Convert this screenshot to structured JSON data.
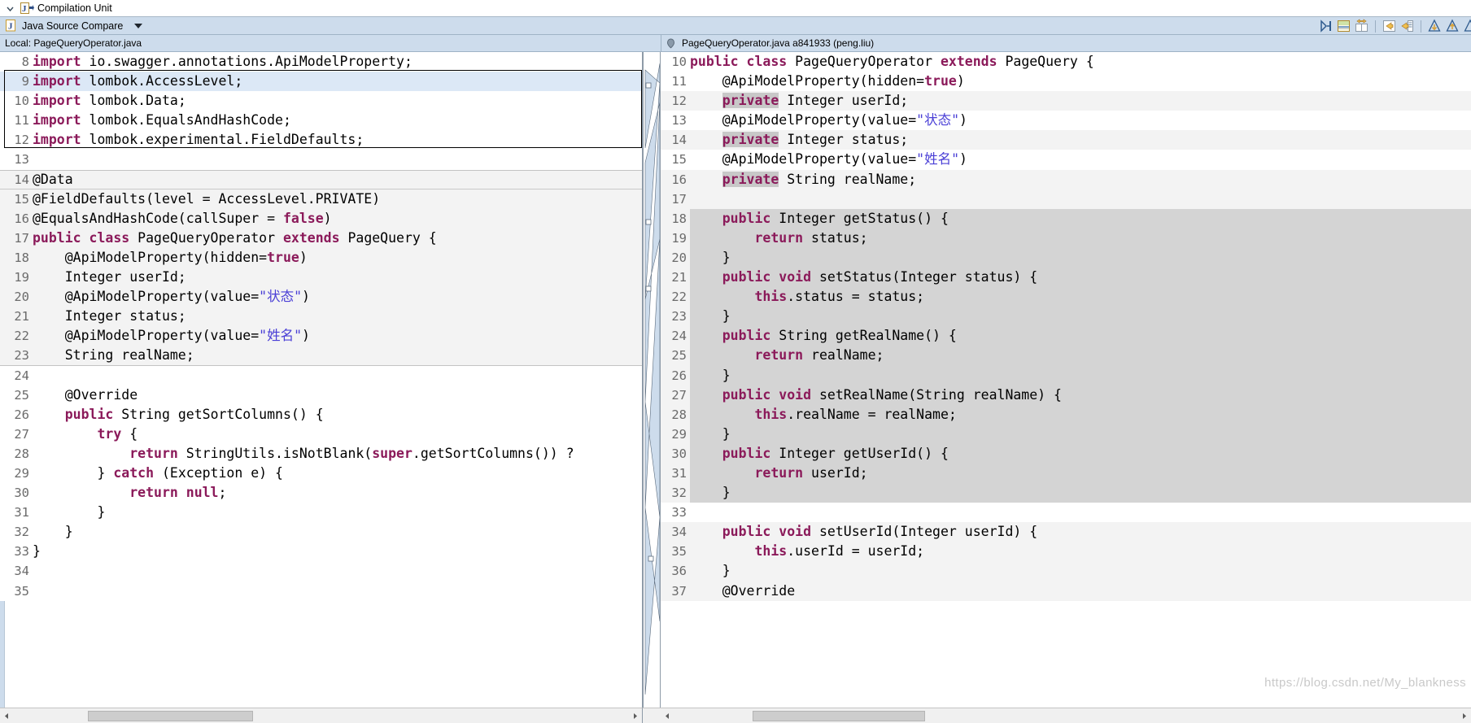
{
  "window": {
    "compilation_unit_label": "Compilation Unit",
    "twisty_icon": "chevron-down-icon",
    "java_file_icon": "java-compilation-unit-icon"
  },
  "compare_bar": {
    "title": "Java Source Compare",
    "icon": "java-file-icon",
    "dropdown_icon": "caret-down-icon",
    "toolbar": [
      {
        "name": "next-difference-icon",
        "tooltip": "Next Difference"
      },
      {
        "name": "two-pane-layout-icon",
        "tooltip": "Two Pane Layout"
      },
      {
        "name": "switch-layout-icon",
        "tooltip": "Switch Layout"
      },
      {
        "name": "copy-all-left-icon",
        "tooltip": "Copy All from Right to Left"
      },
      {
        "name": "copy-current-left-icon",
        "tooltip": "Copy Current Change from Right to Left"
      },
      {
        "name": "next-change-icon",
        "tooltip": "Next Change"
      },
      {
        "name": "previous-change-icon",
        "tooltip": "Previous Change"
      },
      {
        "name": "next-difference-arrow-icon",
        "tooltip": "Next Difference"
      }
    ]
  },
  "panes": {
    "left": {
      "header": "Local: PageQueryOperator.java",
      "first_line_number": 8,
      "lines": [
        {
          "n": 8,
          "bg": "white",
          "tokens": [
            {
              "t": "import",
              "c": "kw"
            },
            {
              "t": " io.swagger.annotations.ApiModelProperty;",
              "c": "pl"
            }
          ]
        },
        {
          "n": 9,
          "bg": "sel",
          "tokens": [
            {
              "t": "import",
              "c": "kw"
            },
            {
              "t": " lombok.AccessLevel;",
              "c": "pl"
            }
          ]
        },
        {
          "n": 10,
          "bg": "white",
          "tokens": [
            {
              "t": "import",
              "c": "kw"
            },
            {
              "t": " lombok.Data;",
              "c": "pl"
            }
          ]
        },
        {
          "n": 11,
          "bg": "white",
          "tokens": [
            {
              "t": "import",
              "c": "kw"
            },
            {
              "t": " lombok.EqualsAndHashCode;",
              "c": "pl"
            }
          ]
        },
        {
          "n": 12,
          "bg": "white",
          "tokens": [
            {
              "t": "import",
              "c": "kw"
            },
            {
              "t": " lombok.experimental.FieldDefaults;",
              "c": "pl"
            }
          ]
        },
        {
          "n": 13,
          "bg": "white",
          "tokens": []
        },
        {
          "n": 14,
          "bg": "greyband",
          "tokens": [
            {
              "t": "@Data",
              "c": "pl"
            }
          ]
        },
        {
          "n": 15,
          "bg": "grey",
          "tokens": [
            {
              "t": "@FieldDefaults(level = AccessLevel.PRIVATE)",
              "c": "pl"
            }
          ]
        },
        {
          "n": 16,
          "bg": "grey",
          "tokens": [
            {
              "t": "@EqualsAndHashCode(callSuper = ",
              "c": "pl"
            },
            {
              "t": "false",
              "c": "kw"
            },
            {
              "t": ")",
              "c": "pl"
            }
          ]
        },
        {
          "n": 17,
          "bg": "grey",
          "tokens": [
            {
              "t": "public class",
              "c": "kw"
            },
            {
              "t": " PageQueryOperator ",
              "c": "pl"
            },
            {
              "t": "extends",
              "c": "kw"
            },
            {
              "t": " PageQuery {",
              "c": "pl"
            }
          ]
        },
        {
          "n": 18,
          "bg": "grey",
          "tokens": [
            {
              "t": "    @ApiModelProperty(hidden=",
              "c": "pl"
            },
            {
              "t": "true",
              "c": "kw"
            },
            {
              "t": ")",
              "c": "pl"
            }
          ]
        },
        {
          "n": 19,
          "bg": "grey",
          "tokens": [
            {
              "t": "    Integer userId;",
              "c": "pl"
            }
          ]
        },
        {
          "n": 20,
          "bg": "grey",
          "tokens": [
            {
              "t": "    @ApiModelProperty(value=",
              "c": "pl"
            },
            {
              "t": "\"状态\"",
              "c": "str"
            },
            {
              "t": ")",
              "c": "pl"
            }
          ]
        },
        {
          "n": 21,
          "bg": "grey",
          "tokens": [
            {
              "t": "    Integer status;",
              "c": "pl"
            }
          ]
        },
        {
          "n": 22,
          "bg": "grey",
          "tokens": [
            {
              "t": "    @ApiModelProperty(value=",
              "c": "pl"
            },
            {
              "t": "\"姓名\"",
              "c": "str"
            },
            {
              "t": ")",
              "c": "pl"
            }
          ]
        },
        {
          "n": 23,
          "bg": "greyend",
          "tokens": [
            {
              "t": "    String realName;",
              "c": "pl"
            }
          ]
        },
        {
          "n": 24,
          "bg": "white",
          "tokens": []
        },
        {
          "n": 25,
          "bg": "white",
          "tokens": [
            {
              "t": "    @Override",
              "c": "pl"
            }
          ]
        },
        {
          "n": 26,
          "bg": "white",
          "tokens": [
            {
              "t": "    ",
              "c": "pl"
            },
            {
              "t": "public",
              "c": "kw"
            },
            {
              "t": " String getSortColumns() {",
              "c": "pl"
            }
          ]
        },
        {
          "n": 27,
          "bg": "white",
          "tokens": [
            {
              "t": "        ",
              "c": "pl"
            },
            {
              "t": "try",
              "c": "kw"
            },
            {
              "t": " {",
              "c": "pl"
            }
          ]
        },
        {
          "n": 28,
          "bg": "white",
          "tokens": [
            {
              "t": "            ",
              "c": "pl"
            },
            {
              "t": "return",
              "c": "kw"
            },
            {
              "t": " StringUtils.isNotBlank(",
              "c": "pl"
            },
            {
              "t": "super",
              "c": "kw"
            },
            {
              "t": ".getSortColumns()) ?",
              "c": "pl"
            }
          ]
        },
        {
          "n": 29,
          "bg": "white",
          "tokens": [
            {
              "t": "        } ",
              "c": "pl"
            },
            {
              "t": "catch",
              "c": "kw"
            },
            {
              "t": " (Exception e) {",
              "c": "pl"
            }
          ]
        },
        {
          "n": 30,
          "bg": "white",
          "tokens": [
            {
              "t": "            ",
              "c": "pl"
            },
            {
              "t": "return null",
              "c": "kw"
            },
            {
              "t": ";",
              "c": "pl"
            }
          ]
        },
        {
          "n": 31,
          "bg": "white",
          "tokens": [
            {
              "t": "        }",
              "c": "pl"
            }
          ]
        },
        {
          "n": 32,
          "bg": "white",
          "tokens": [
            {
              "t": "    }",
              "c": "pl"
            }
          ]
        },
        {
          "n": 33,
          "bg": "white",
          "tokens": [
            {
              "t": "}",
              "c": "pl"
            }
          ]
        },
        {
          "n": 34,
          "bg": "white",
          "tokens": []
        },
        {
          "n": 35,
          "bg": "white",
          "tokens": []
        }
      ]
    },
    "right": {
      "header": "PageQueryOperator.java a841933 (peng.liu)",
      "first_line_number": 10,
      "lines": [
        {
          "n": 10,
          "bg": "white",
          "tokens": [
            {
              "t": "public class",
              "c": "kw"
            },
            {
              "t": " PageQueryOperator ",
              "c": "pl"
            },
            {
              "t": "extends",
              "c": "kw"
            },
            {
              "t": " PageQuery {",
              "c": "pl"
            }
          ]
        },
        {
          "n": 11,
          "bg": "white",
          "tokens": [
            {
              "t": "    @ApiModelProperty(hidden=",
              "c": "pl"
            },
            {
              "t": "true",
              "c": "kw"
            },
            {
              "t": ")",
              "c": "pl"
            }
          ]
        },
        {
          "n": 12,
          "bg": "grey",
          "tokens": [
            {
              "t": "    ",
              "c": "pl"
            },
            {
              "t": "private",
              "c": "kw hl"
            },
            {
              "t": " Integer userId;",
              "c": "pl"
            }
          ]
        },
        {
          "n": 13,
          "bg": "white",
          "tokens": [
            {
              "t": "    @ApiModelProperty(value=",
              "c": "pl"
            },
            {
              "t": "\"状态\"",
              "c": "str"
            },
            {
              "t": ")",
              "c": "pl"
            }
          ]
        },
        {
          "n": 14,
          "bg": "grey",
          "tokens": [
            {
              "t": "    ",
              "c": "pl"
            },
            {
              "t": "private",
              "c": "kw hl"
            },
            {
              "t": " Integer status;",
              "c": "pl"
            }
          ]
        },
        {
          "n": 15,
          "bg": "white",
          "tokens": [
            {
              "t": "    @ApiModelProperty(value=",
              "c": "pl"
            },
            {
              "t": "\"姓名\"",
              "c": "str"
            },
            {
              "t": ")",
              "c": "pl"
            }
          ]
        },
        {
          "n": 16,
          "bg": "grey",
          "tokens": [
            {
              "t": "    ",
              "c": "pl"
            },
            {
              "t": "private",
              "c": "kw hl"
            },
            {
              "t": " String realName;",
              "c": "pl"
            }
          ]
        },
        {
          "n": 17,
          "bg": "grey",
          "tokens": []
        },
        {
          "n": 18,
          "bg": "dark",
          "tokens": [
            {
              "t": "    ",
              "c": "pl"
            },
            {
              "t": "public",
              "c": "kw"
            },
            {
              "t": " Integer getStatus() {",
              "c": "pl"
            }
          ]
        },
        {
          "n": 19,
          "bg": "dark",
          "tokens": [
            {
              "t": "        ",
              "c": "pl"
            },
            {
              "t": "return",
              "c": "kw"
            },
            {
              "t": " status;",
              "c": "pl"
            }
          ]
        },
        {
          "n": 20,
          "bg": "dark",
          "tokens": [
            {
              "t": "    }",
              "c": "pl"
            }
          ]
        },
        {
          "n": 21,
          "bg": "dark",
          "tokens": [
            {
              "t": "    ",
              "c": "pl"
            },
            {
              "t": "public void",
              "c": "kw"
            },
            {
              "t": " setStatus(Integer status) {",
              "c": "pl"
            }
          ]
        },
        {
          "n": 22,
          "bg": "dark",
          "tokens": [
            {
              "t": "        ",
              "c": "pl"
            },
            {
              "t": "this",
              "c": "kw"
            },
            {
              "t": ".status = status;",
              "c": "pl"
            }
          ]
        },
        {
          "n": 23,
          "bg": "dark",
          "tokens": [
            {
              "t": "    }",
              "c": "pl"
            }
          ]
        },
        {
          "n": 24,
          "bg": "dark",
          "tokens": [
            {
              "t": "    ",
              "c": "pl"
            },
            {
              "t": "public",
              "c": "kw"
            },
            {
              "t": " String getRealName() {",
              "c": "pl"
            }
          ]
        },
        {
          "n": 25,
          "bg": "dark",
          "tokens": [
            {
              "t": "        ",
              "c": "pl"
            },
            {
              "t": "return",
              "c": "kw"
            },
            {
              "t": " realName;",
              "c": "pl"
            }
          ]
        },
        {
          "n": 26,
          "bg": "dark",
          "tokens": [
            {
              "t": "    }",
              "c": "pl"
            }
          ]
        },
        {
          "n": 27,
          "bg": "dark",
          "tokens": [
            {
              "t": "    ",
              "c": "pl"
            },
            {
              "t": "public void",
              "c": "kw"
            },
            {
              "t": " setRealName(String realName) {",
              "c": "pl"
            }
          ]
        },
        {
          "n": 28,
          "bg": "dark",
          "tokens": [
            {
              "t": "        ",
              "c": "pl"
            },
            {
              "t": "this",
              "c": "kw"
            },
            {
              "t": ".realName = realName;",
              "c": "pl"
            }
          ]
        },
        {
          "n": 29,
          "bg": "dark",
          "tokens": [
            {
              "t": "    }",
              "c": "pl"
            }
          ]
        },
        {
          "n": 30,
          "bg": "dark",
          "tokens": [
            {
              "t": "    ",
              "c": "pl"
            },
            {
              "t": "public",
              "c": "kw"
            },
            {
              "t": " Integer getUserId() {",
              "c": "pl"
            }
          ]
        },
        {
          "n": 31,
          "bg": "dark",
          "tokens": [
            {
              "t": "        ",
              "c": "pl"
            },
            {
              "t": "return",
              "c": "kw"
            },
            {
              "t": " userId;",
              "c": "pl"
            }
          ]
        },
        {
          "n": 32,
          "bg": "darkend",
          "tokens": [
            {
              "t": "    }",
              "c": "pl"
            }
          ]
        },
        {
          "n": 33,
          "bg": "white",
          "tokens": []
        },
        {
          "n": 34,
          "bg": "grey",
          "tokens": [
            {
              "t": "    ",
              "c": "pl"
            },
            {
              "t": "public void",
              "c": "kw"
            },
            {
              "t": " setUserId(Integer userId) {",
              "c": "pl"
            }
          ]
        },
        {
          "n": 35,
          "bg": "grey",
          "tokens": [
            {
              "t": "        ",
              "c": "pl"
            },
            {
              "t": "this",
              "c": "kw"
            },
            {
              "t": ".userId = userId;",
              "c": "pl"
            }
          ]
        },
        {
          "n": 36,
          "bg": "grey",
          "tokens": [
            {
              "t": "    }",
              "c": "pl"
            }
          ]
        },
        {
          "n": 37,
          "bg": "grey",
          "tokens": [
            {
              "t": "    @Override",
              "c": "pl"
            }
          ]
        }
      ]
    }
  },
  "scrollbars": {
    "left_thumb_left_pct": 12,
    "left_thumb_width_pct": 27,
    "right_thumb_left_pct": 10,
    "right_thumb_width_pct": 22,
    "left_arrow_icon": "scroll-left-arrow-icon",
    "right_arrow_icon": "scroll-right-arrow-icon"
  },
  "watermark": {
    "text": "https://blog.csdn.net/My_blankness"
  },
  "colors": {
    "header_bg": "#cddcec",
    "keyword": "#8b1a5a",
    "string": "#4a3fd6",
    "diff_light": "#f3f3f3",
    "diff_dark": "#d4d4d4",
    "selection": "#dce8f6"
  }
}
